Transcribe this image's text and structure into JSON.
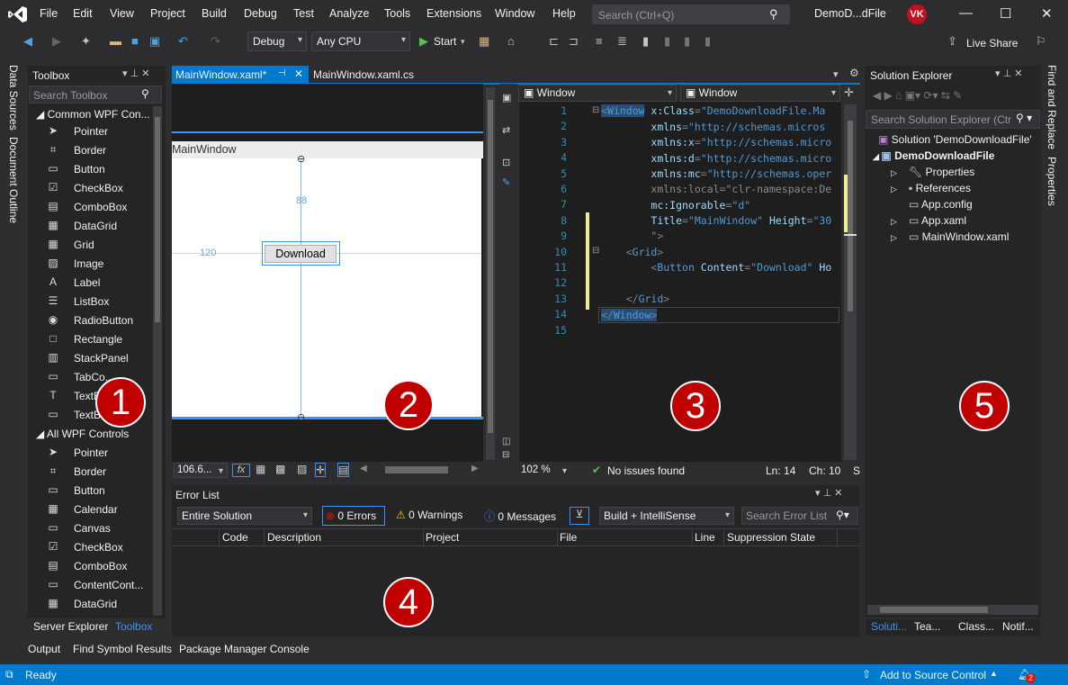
{
  "menubar": {
    "items": [
      "File",
      "Edit",
      "View",
      "Project",
      "Build",
      "Debug",
      "Test",
      "Analyze",
      "Tools",
      "Extensions",
      "Window",
      "Help"
    ],
    "search_placeholder": "Search (Ctrl+Q)",
    "solution_title": "DemoD...dFile",
    "avatar_initials": "VK"
  },
  "toolbar": {
    "config": "Debug",
    "platform": "Any CPU",
    "start_label": "Start",
    "live_share": "Live Share"
  },
  "side_tabs": {
    "data_sources": "Data Sources",
    "document_outline": "Document Outline",
    "find_replace": "Find and Replace",
    "properties": "Properties"
  },
  "toolbox": {
    "title": "Toolbox",
    "search_placeholder": "Search Toolbox",
    "group1": "Common WPF Con...",
    "group1_items": [
      "Pointer",
      "Border",
      "Button",
      "CheckBox",
      "ComboBox",
      "DataGrid",
      "Grid",
      "Image",
      "Label",
      "ListBox",
      "RadioButton",
      "Rectangle",
      "StackPanel",
      "TabCo...",
      "TextB...",
      "TextB..."
    ],
    "group2": "All WPF Controls",
    "group2_items": [
      "Pointer",
      "Border",
      "Button",
      "Calendar",
      "Canvas",
      "CheckBox",
      "ComboBox",
      "ContentCont...",
      "DataGrid"
    ],
    "bottom_tabs": [
      "Server Explorer",
      "Toolbox"
    ]
  },
  "doc_tabs": {
    "active": "MainWindow.xaml*",
    "other": "MainWindow.xaml.cs"
  },
  "designer": {
    "window_title": "MainWindow",
    "button_label": "Download",
    "dim_top": "88",
    "dim_left": "120",
    "zoom": "106.6...",
    "fx": "fx"
  },
  "editor": {
    "left_dropdown": "Window",
    "right_dropdown": "Window",
    "line_numbers": [
      "1",
      "2",
      "3",
      "4",
      "5",
      "6",
      "7",
      "8",
      "9",
      "10",
      "11",
      "12",
      "13",
      "14",
      "15"
    ],
    "zoom": "102 %",
    "issues": "No issues found",
    "ln": "Ln: 14",
    "ch": "Ch: 10",
    "sp": "S"
  },
  "solution_explorer": {
    "title": "Solution Explorer",
    "search_placeholder": "Search Solution Explorer (Ctr",
    "solution": "Solution 'DemoDownloadFile'",
    "project": "DemoDownloadFile",
    "items": [
      "Properties",
      "References",
      "App.config",
      "App.xaml",
      "MainWindow.xaml"
    ],
    "bottom_tabs": [
      "Soluti...",
      "Tea...",
      "Class...",
      "Notif..."
    ]
  },
  "error_list": {
    "title": "Error List",
    "scope": "Entire Solution",
    "errors": "0 Errors",
    "warnings": "0 Warnings",
    "messages": "0 Messages",
    "build": "Build + IntelliSense",
    "search_placeholder": "Search Error List",
    "columns": [
      "Code",
      "Description",
      "Project",
      "File",
      "Line",
      "Suppression State"
    ]
  },
  "bottom_tabs": [
    "Output",
    "Find Symbol Results",
    "Package Manager Console"
  ],
  "status": {
    "ready": "Ready",
    "source_control": "Add to Source Control",
    "notifications": "2"
  },
  "badges": [
    "1",
    "2",
    "3",
    "4",
    "5"
  ],
  "colors": {
    "accent": "#007acc",
    "badge": "#c00000",
    "background": "#2d2d30",
    "panel": "#252526"
  }
}
